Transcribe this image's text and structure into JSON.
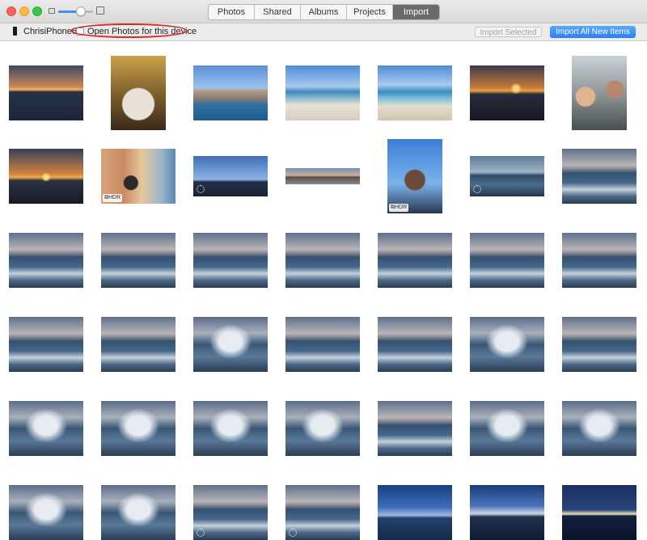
{
  "window": {
    "tabs": [
      {
        "label": "Photos",
        "active": false
      },
      {
        "label": "Shared",
        "active": false
      },
      {
        "label": "Albums",
        "active": false
      },
      {
        "label": "Projects",
        "active": false
      },
      {
        "label": "Import",
        "active": true
      }
    ]
  },
  "zoom": {
    "level": 0.65,
    "icon_small": "small-photo-icon",
    "icon_large": "large-photo-icon"
  },
  "device": {
    "name": "ChrisiPhone6s",
    "icon": "iphone-icon"
  },
  "open_photos": {
    "label": "Open Photos for this device",
    "checked": false
  },
  "buttons": {
    "import_selected": "Import Selected",
    "import_all": "Import All New Items"
  },
  "colors": {
    "accent": "#2b7ff4",
    "annotation": "#d42a2a",
    "toolbar": "#ececec"
  },
  "thumbs": [
    {
      "scene": "harbor-sunset"
    },
    {
      "scene": "dinner"
    },
    {
      "scene": "town-day"
    },
    {
      "scene": "beach"
    },
    {
      "scene": "beach-people"
    },
    {
      "scene": "cliff-sunset"
    },
    {
      "scene": "selfie-portrait"
    },
    {
      "scene": "sunset-sea"
    },
    {
      "scene": "town-person",
      "badge": "HDR"
    },
    {
      "scene": "town-silhouette",
      "live": true
    },
    {
      "scene": "panorama"
    },
    {
      "scene": "man-selfie",
      "badge": "HDR"
    },
    {
      "scene": "sea-rocks",
      "live": true
    },
    {
      "scene": "waves"
    },
    {
      "scene": "waves"
    },
    {
      "scene": "waves"
    },
    {
      "scene": "waves"
    },
    {
      "scene": "waves"
    },
    {
      "scene": "waves"
    },
    {
      "scene": "waves"
    },
    {
      "scene": "waves"
    },
    {
      "scene": "waves"
    },
    {
      "scene": "waves"
    },
    {
      "scene": "splash"
    },
    {
      "scene": "waves"
    },
    {
      "scene": "waves"
    },
    {
      "scene": "splash"
    },
    {
      "scene": "waves"
    },
    {
      "scene": "splash"
    },
    {
      "scene": "splash"
    },
    {
      "scene": "splash"
    },
    {
      "scene": "splash"
    },
    {
      "scene": "waves"
    },
    {
      "scene": "splash"
    },
    {
      "scene": "splash"
    },
    {
      "scene": "splash"
    },
    {
      "scene": "splash"
    },
    {
      "scene": "waves",
      "live": true
    },
    {
      "scene": "waves",
      "live": true
    },
    {
      "scene": "dusk"
    },
    {
      "scene": "dusk-pier"
    },
    {
      "scene": "night-shore"
    }
  ]
}
